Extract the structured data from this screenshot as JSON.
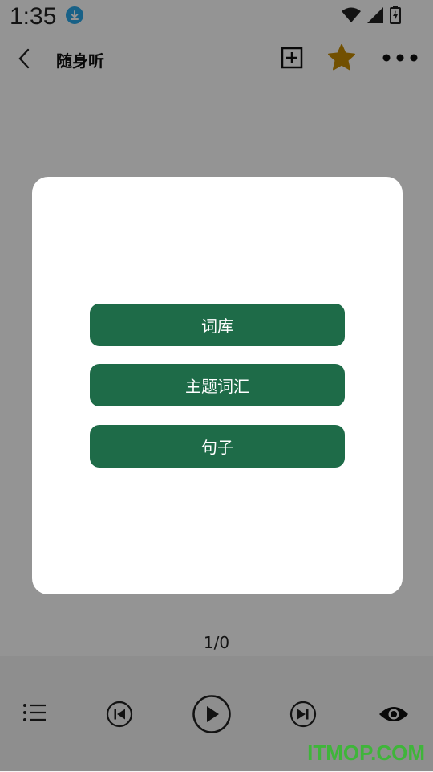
{
  "status_bar": {
    "time": "1:35"
  },
  "app_bar": {
    "title": "随身听"
  },
  "player": {
    "counter": "1/0"
  },
  "dialog": {
    "options": [
      {
        "label": "词库"
      },
      {
        "label": "主题词汇"
      },
      {
        "label": "句子"
      }
    ]
  },
  "colors": {
    "button_bg": "#1e6b48",
    "star": "#c58a00",
    "watermark": "#3fb53a"
  },
  "icons": [
    "download-icon",
    "wifi-icon",
    "signal-icon",
    "battery-icon",
    "back-icon",
    "add-box-icon",
    "star-icon",
    "more-icon",
    "playlist-icon",
    "previous-icon",
    "play-icon",
    "next-icon",
    "eye-icon"
  ],
  "watermark": "ITMOP.COM"
}
